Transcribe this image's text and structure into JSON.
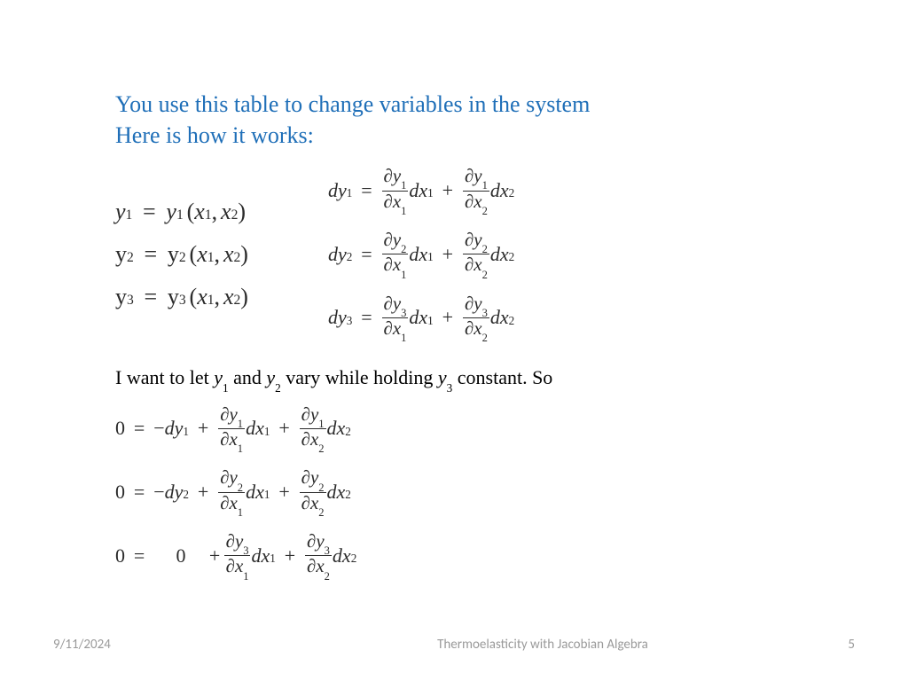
{
  "heading": {
    "line1": "You use this table to change variables in the system",
    "line2": "Here is how it works:"
  },
  "definitions": {
    "y1": {
      "lhs_var": "y",
      "lhs_sub": "1",
      "rhs_var": "y",
      "rhs_sub": "1",
      "arg1_var": "x",
      "arg1_sub": "1",
      "arg2_var": "x",
      "arg2_sub": "2"
    },
    "y2": {
      "lhs_var": "y",
      "lhs_sub": "2",
      "rhs_var": "y",
      "rhs_sub": "2",
      "arg1_var": "x",
      "arg1_sub": "1",
      "arg2_var": "x",
      "arg2_sub": "2"
    },
    "y3": {
      "lhs_var": "y",
      "lhs_sub": "3",
      "rhs_var": "y",
      "rhs_sub": "3",
      "arg1_var": "x",
      "arg1_sub": "1",
      "arg2_var": "x",
      "arg2_sub": "2"
    }
  },
  "totdiff": {
    "d1": {
      "lhs_v": "y",
      "lhs_s": "1",
      "t1_num_v": "y",
      "t1_num_s": "1",
      "t1_den_v": "x",
      "t1_den_s": "1",
      "t1_dx_v": "x",
      "t1_dx_s": "1",
      "t2_num_v": "y",
      "t2_num_s": "1",
      "t2_den_v": "x",
      "t2_den_s": "2",
      "t2_dx_v": "x",
      "t2_dx_s": "2"
    },
    "d2": {
      "lhs_v": "y",
      "lhs_s": "2",
      "t1_num_v": "y",
      "t1_num_s": "2",
      "t1_den_v": "x",
      "t1_den_s": "1",
      "t1_dx_v": "x",
      "t1_dx_s": "1",
      "t2_num_v": "y",
      "t2_num_s": "2",
      "t2_den_v": "x",
      "t2_den_s": "2",
      "t2_dx_v": "x",
      "t2_dx_s": "2"
    },
    "d3": {
      "lhs_v": "y",
      "lhs_s": "3",
      "t1_num_v": "y",
      "t1_num_s": "3",
      "t1_den_v": "x",
      "t1_den_s": "1",
      "t1_dx_v": "x",
      "t1_dx_s": "1",
      "t2_num_v": "y",
      "t2_num_s": "3",
      "t2_den_v": "x",
      "t2_den_s": "2",
      "t2_dx_v": "x",
      "t2_dx_s": "2"
    }
  },
  "midtext": {
    "p1": "I want to let ",
    "v1": "y",
    "s1": "1",
    "p2": " and ",
    "v2": "y",
    "s2": "2",
    "p3": " vary while holding ",
    "v3": "y",
    "s3": "3",
    "p4": "  constant. So"
  },
  "constraints": {
    "c1": {
      "zero": "0",
      "neg": "−",
      "dy_v": "y",
      "dy_s": "1",
      "t1_num_v": "y",
      "t1_num_s": "1",
      "t1_den_v": "x",
      "t1_den_s": "1",
      "t1_dx_v": "x",
      "t1_dx_s": "1",
      "t2_num_v": "y",
      "t2_num_s": "1",
      "t2_den_v": "x",
      "t2_den_s": "2",
      "t2_dx_v": "x",
      "t2_dx_s": "2"
    },
    "c2": {
      "zero": "0",
      "neg": "−",
      "dy_v": "y",
      "dy_s": "2",
      "t1_num_v": "y",
      "t1_num_s": "2",
      "t1_den_v": "x",
      "t1_den_s": "1",
      "t1_dx_v": "x",
      "t1_dx_s": "1",
      "t2_num_v": "y",
      "t2_num_s": "2",
      "t2_den_v": "x",
      "t2_den_s": "2",
      "t2_dx_v": "x",
      "t2_dx_s": "2"
    },
    "c3": {
      "zero": "0",
      "mid_zero": "0",
      "t1_num_v": "y",
      "t1_num_s": "3",
      "t1_den_v": "x",
      "t1_den_s": "1",
      "t1_dx_v": "x",
      "t1_dx_s": "1",
      "t2_num_v": "y",
      "t2_num_s": "3",
      "t2_den_v": "x",
      "t2_den_s": "2",
      "t2_dx_v": "x",
      "t2_dx_s": "2"
    }
  },
  "glyph": {
    "d": "d",
    "partial": "∂",
    "eq": "=",
    "plus": "+",
    "lp": "(",
    "rp": ")",
    "comma": ","
  },
  "footer": {
    "date": "9/11/2024",
    "title": "Thermoelasticity with Jacobian Algebra",
    "page": "5"
  }
}
